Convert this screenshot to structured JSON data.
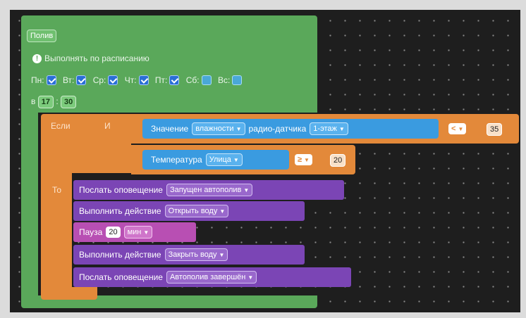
{
  "program": {
    "title": "Полив",
    "schedule_label": "Выполнять по расписанию",
    "days": [
      {
        "label": "Пн:",
        "checked": true
      },
      {
        "label": "Вт:",
        "checked": true
      },
      {
        "label": "Ср:",
        "checked": true
      },
      {
        "label": "Чт:",
        "checked": true
      },
      {
        "label": "Пт:",
        "checked": true
      },
      {
        "label": "Сб:",
        "checked": false
      },
      {
        "label": "Вс:",
        "checked": false
      }
    ],
    "time_prefix": "в",
    "hour": "17",
    "time_sep": ":",
    "minute": "30"
  },
  "if_block": {
    "if_label": "Если",
    "and_label": "И",
    "then_label": "То",
    "cond1": {
      "label": "Значение",
      "param": "влажности",
      "source_label": "радио-датчика",
      "sensor": "1-этаж",
      "operator": "<",
      "value": "35"
    },
    "cond2": {
      "label": "Температура",
      "location": "Улица",
      "operator": "≥",
      "value": "20"
    }
  },
  "actions": [
    {
      "label": "Послать оповещение",
      "value": "Запущен автополив"
    },
    {
      "label": "Выполнить действие",
      "value": "Открыть воду"
    },
    {
      "label": "Пауза",
      "number": "20",
      "unit": "мин"
    },
    {
      "label": "Выполнить действие",
      "value": "Закрыть воду"
    },
    {
      "label": "Послать оповещение",
      "value": "Автополив завершён"
    }
  ],
  "colors": {
    "program_block": "#5aa85a",
    "if_block": "#e3893a",
    "condition_block": "#3a9be0",
    "action_block": "#7b45b5",
    "pause_block": "#b84fb3",
    "workspace": "#1e1e1e"
  },
  "icons": {
    "info": "info-icon",
    "dropdown": "caret-down-icon",
    "checkbox": "checkbox-icon"
  }
}
